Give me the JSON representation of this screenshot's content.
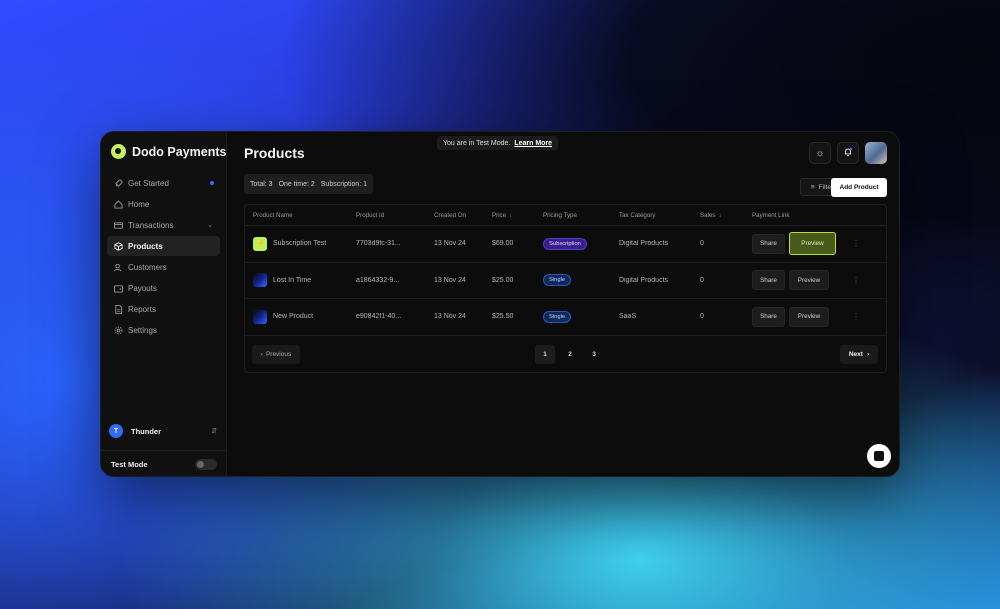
{
  "banner": {
    "text": "You are in Test Mode.",
    "link": "Learn More"
  },
  "brand": {
    "name": "Dodo Payments"
  },
  "sidebar": {
    "items": [
      {
        "label": "Get Started",
        "icon": "rocket-icon"
      },
      {
        "label": "Home",
        "icon": "home-icon"
      },
      {
        "label": "Transactions",
        "icon": "card-icon"
      },
      {
        "label": "Products",
        "icon": "box-icon",
        "active": true
      },
      {
        "label": "Customers",
        "icon": "users-icon"
      },
      {
        "label": "Payouts",
        "icon": "wallet-icon"
      },
      {
        "label": "Reports",
        "icon": "report-icon"
      },
      {
        "label": "Settings",
        "icon": "gear-icon"
      }
    ],
    "user": {
      "initial": "T",
      "name": "Thunder"
    },
    "test_mode_label": "Test Mode"
  },
  "page": {
    "title": "Products"
  },
  "stats": {
    "total": "Total: 3",
    "one_time": "One time: 2",
    "subscription": "Subscription: 1"
  },
  "toolbar": {
    "filter_label": "Filter",
    "add_label": "Add Product"
  },
  "table": {
    "columns": [
      "Product Name",
      "Product Id",
      "Created On",
      "Price",
      "Pricing Type",
      "Tax Category",
      "Sales",
      "Payment Link"
    ],
    "rows": [
      {
        "name": "Subscription Test",
        "id": "7703d9fc-31...",
        "created": "13 Nov 24",
        "price": "$69.00",
        "pricing_type": "Subscription",
        "tax": "Digital Products",
        "sales": "0",
        "share": "Share",
        "preview": "Preview"
      },
      {
        "name": "Lost In Time",
        "id": "a1864332-9...",
        "created": "13 Nov 24",
        "price": "$25.00",
        "pricing_type": "Single",
        "tax": "Digital Products",
        "sales": "0",
        "share": "Share",
        "preview": "Preview"
      },
      {
        "name": "New Product",
        "id": "e90842f1-40...",
        "created": "13 Nov 24",
        "price": "$25.50",
        "pricing_type": "Single",
        "tax": "SaaS",
        "sales": "0",
        "share": "Share",
        "preview": "Preview"
      }
    ]
  },
  "pagination": {
    "previous": "Previous",
    "pages": [
      "1",
      "2",
      "3"
    ],
    "next": "Next"
  },
  "colors": {
    "accent": "#b7f25c",
    "subscription_badge": "#3a1f8c",
    "single_badge": "#0f2a5a"
  }
}
